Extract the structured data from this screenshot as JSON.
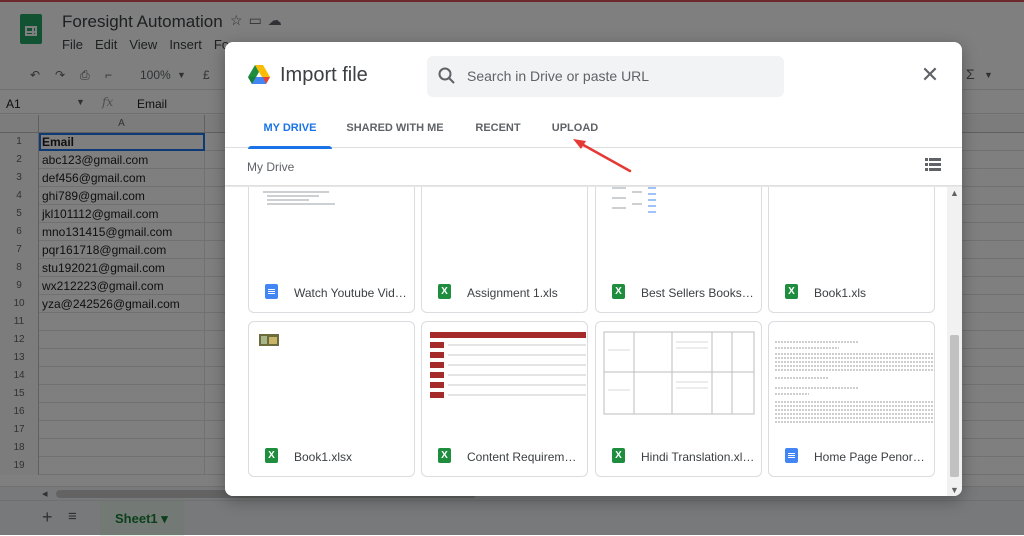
{
  "app": {
    "doc_title": "Foresight Automation",
    "menu": [
      "File",
      "Edit",
      "View",
      "Insert",
      "Fo"
    ],
    "zoom": "100%",
    "currency": "£",
    "sigma": "Σ",
    "cell_ref": "A1",
    "fx": "fx",
    "formula_value": "Email",
    "column_a": "A",
    "rows": [
      {
        "n": "1",
        "v": "Email"
      },
      {
        "n": "2",
        "v": "abc123@gmail.com"
      },
      {
        "n": "3",
        "v": "def456@gmail.com"
      },
      {
        "n": "4",
        "v": "ghi789@gmail.com"
      },
      {
        "n": "5",
        "v": "jkl101112@gmail.com"
      },
      {
        "n": "6",
        "v": "mno131415@gmail.com"
      },
      {
        "n": "7",
        "v": "pqr161718@gmail.com"
      },
      {
        "n": "8",
        "v": "stu192021@gmail.com"
      },
      {
        "n": "9",
        "v": "wx212223@gmail.com"
      },
      {
        "n": "10",
        "v": "yza@242526@gmail.com"
      },
      {
        "n": "11",
        "v": ""
      },
      {
        "n": "12",
        "v": ""
      },
      {
        "n": "13",
        "v": ""
      },
      {
        "n": "14",
        "v": ""
      },
      {
        "n": "15",
        "v": ""
      },
      {
        "n": "16",
        "v": ""
      },
      {
        "n": "17",
        "v": ""
      },
      {
        "n": "18",
        "v": ""
      },
      {
        "n": "19",
        "v": ""
      }
    ],
    "sheet_tab": "Sheet1 ▾"
  },
  "dialog": {
    "title": "Import file",
    "search_placeholder": "Search in Drive or paste URL",
    "close": "✕",
    "tabs": [
      {
        "label": "MY DRIVE",
        "active": true
      },
      {
        "label": "SHARED WITH ME"
      },
      {
        "label": "RECENT"
      },
      {
        "label": "UPLOAD"
      }
    ],
    "breadcrumb": "My Drive",
    "files": [
      {
        "name": "Watch Youtube Vide...",
        "type": "doc"
      },
      {
        "name": "Assignment 1.xls",
        "type": "xls"
      },
      {
        "name": "Best Sellers Books.x...",
        "type": "xls"
      },
      {
        "name": "Book1.xls",
        "type": "xls"
      },
      {
        "name": "Book1.xlsx",
        "type": "xls"
      },
      {
        "name": "Content Requiremen...",
        "type": "xls"
      },
      {
        "name": "Hindi Translation.xls...",
        "type": "xls"
      },
      {
        "name": "Home Page Penorg ...",
        "type": "doc"
      }
    ]
  },
  "colors": {
    "accent": "#1a73e8",
    "sheets_green": "#188038",
    "arrow_red": "#e53935"
  }
}
